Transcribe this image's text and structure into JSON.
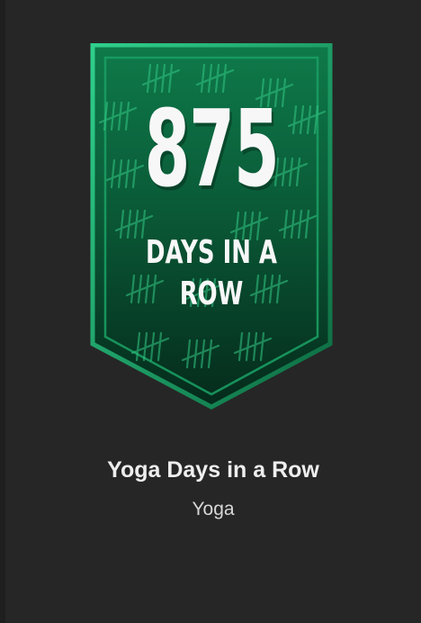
{
  "badge": {
    "count": "875",
    "caption": "DAYS IN A ROW",
    "colors": {
      "dark": "#07301f",
      "mid": "#0d6b41",
      "light": "#1fbf7a",
      "tally": "#36d38f"
    }
  },
  "achievement": {
    "title": "Yoga Days in a Row",
    "category": "Yoga"
  }
}
